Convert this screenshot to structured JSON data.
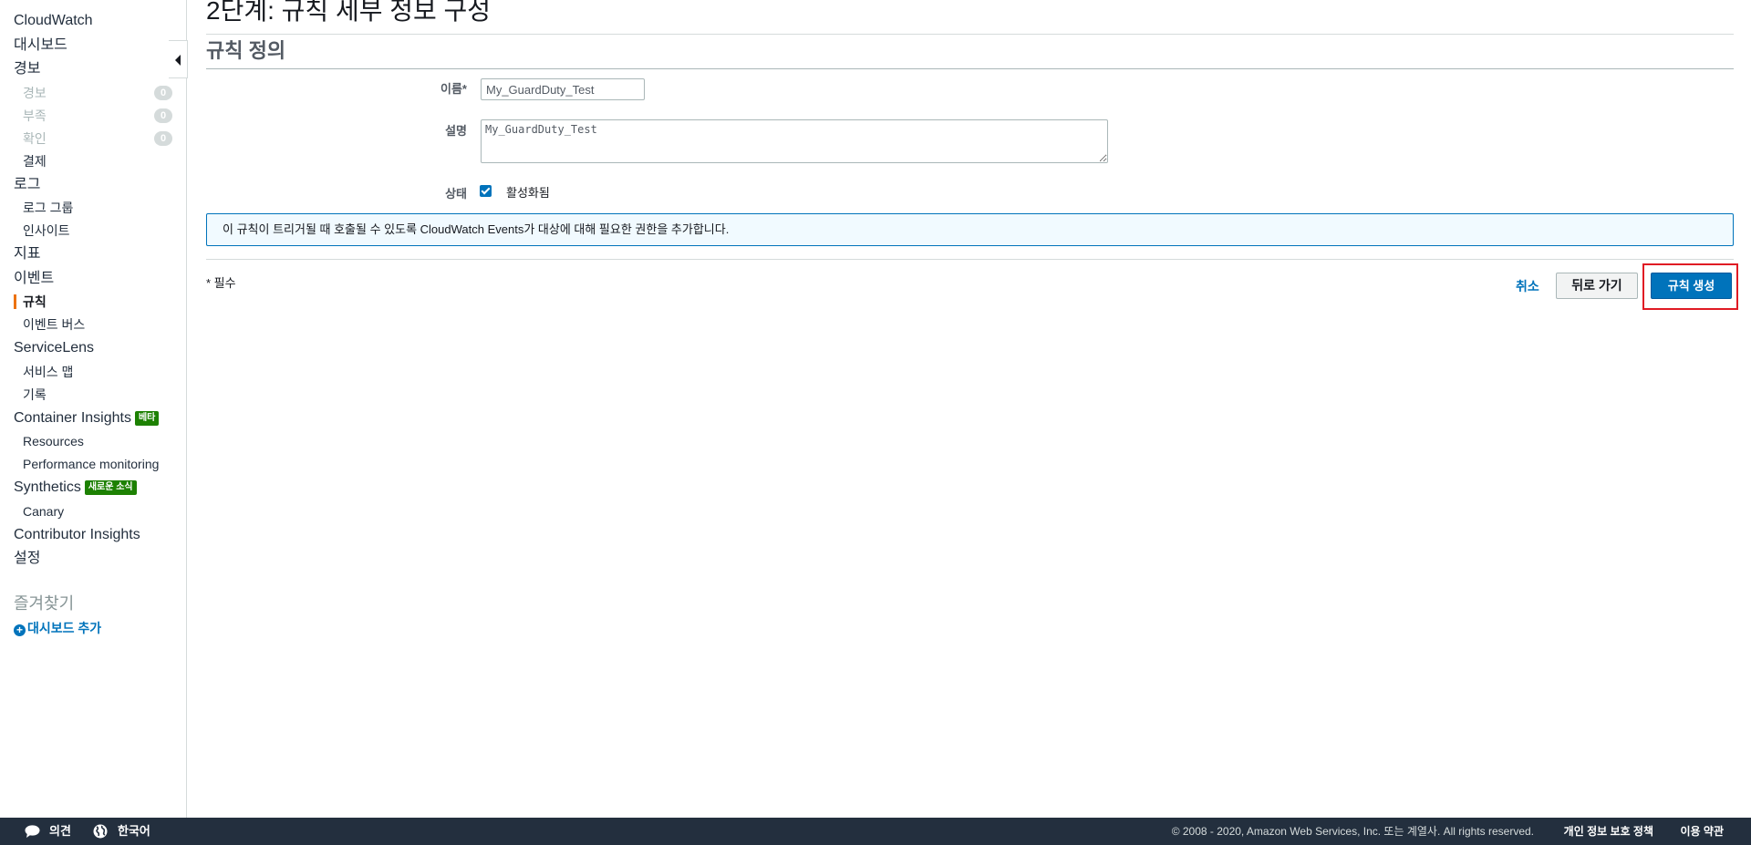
{
  "sidebar": {
    "items": [
      {
        "label": "CloudWatch"
      },
      {
        "label": "대시보드"
      },
      {
        "label": "경보"
      },
      {
        "label": "경보",
        "count": "0"
      },
      {
        "label": "부족",
        "count": "0"
      },
      {
        "label": "확인",
        "count": "0"
      },
      {
        "label": "결제"
      },
      {
        "label": "로그"
      },
      {
        "label": "로그 그룹"
      },
      {
        "label": "인사이트"
      },
      {
        "label": "지표"
      },
      {
        "label": "이벤트"
      },
      {
        "label": "규칙"
      },
      {
        "label": "이벤트 버스"
      },
      {
        "label": "ServiceLens"
      },
      {
        "label": "서비스 맵"
      },
      {
        "label": "기록"
      },
      {
        "label": "Container Insights",
        "badge": "베타"
      },
      {
        "label": "Resources"
      },
      {
        "label": "Performance monitoring"
      },
      {
        "label": "Synthetics",
        "badge": "새로운 소식"
      },
      {
        "label": "Canary"
      },
      {
        "label": "Contributor Insights"
      },
      {
        "label": "설정"
      }
    ],
    "favorites_title": "즐겨찾기",
    "add_dashboard": "대시보드 추가",
    "add_icon_glyph": "+"
  },
  "main": {
    "page_title": "2단계: 규칙 세부 정보 구성",
    "section_title": "규칙 정의",
    "name_label": "이름*",
    "name_value": "My_GuardDuty_Test",
    "description_label": "설명",
    "description_value": "My_GuardDuty_Test",
    "state_label": "상태",
    "state_checkbox_label": "활성화됨",
    "state_checked": true,
    "info_text": "이 규칙이 트리거될 때 호출될 수 있도록 CloudWatch Events가 대상에 대해 필요한 권한을 추가합니다.",
    "required_note": "* 필수",
    "cancel_label": "취소",
    "back_label": "뒤로 가기",
    "create_label": "규칙 생성"
  },
  "footer": {
    "feedback_label": "의견",
    "language_label": "한국어",
    "copyright": "© 2008 - 2020, Amazon Web Services, Inc. 또는 계열사. All rights reserved.",
    "privacy_label": "개인 정보 보호 정책",
    "terms_label": "이용 약관"
  },
  "colors": {
    "accent": "#0073bb",
    "active_indicator": "#ec7211",
    "badge_green": "#1d8102",
    "highlight_red": "#e01b24",
    "footer_bg": "#232f3e"
  }
}
